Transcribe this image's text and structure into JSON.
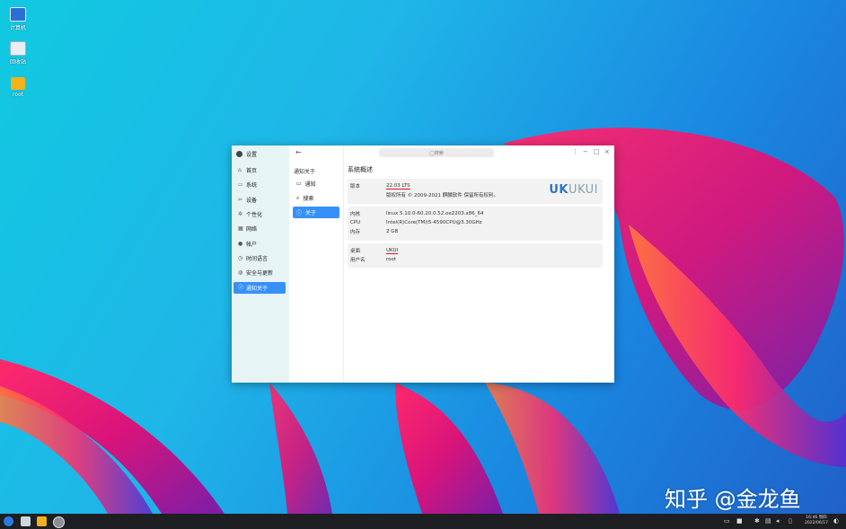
{
  "desktop": {
    "icons": [
      {
        "label": "计算机",
        "icon": "computer-icon"
      },
      {
        "label": "回收站",
        "icon": "trash-icon"
      },
      {
        "label": "root",
        "icon": "home-folder-icon"
      }
    ]
  },
  "window": {
    "title": "设置",
    "search_placeholder": "◯搜索",
    "nav": [
      {
        "label": "首页",
        "icon": "home-icon"
      },
      {
        "label": "系统",
        "icon": "system-icon"
      },
      {
        "label": "设备",
        "icon": "devices-icon"
      },
      {
        "label": "个性化",
        "icon": "personalize-icon"
      },
      {
        "label": "网络",
        "icon": "network-icon"
      },
      {
        "label": "帐户",
        "icon": "account-icon"
      },
      {
        "label": "时间语言",
        "icon": "time-language-icon"
      },
      {
        "label": "安全与更新",
        "icon": "security-update-icon"
      },
      {
        "label": "通知关于",
        "icon": "about-icon",
        "active": true
      }
    ],
    "sub": {
      "heading": "通知关于",
      "items": [
        {
          "label": "通知",
          "icon": "notification-icon"
        },
        {
          "label": "搜索",
          "icon": "search-icon"
        },
        {
          "label": "关于",
          "icon": "info-icon",
          "active": true
        }
      ]
    },
    "about": {
      "heading": "系统概述",
      "version_label": "版本",
      "version_value": "22.03 LTS",
      "copyright": "版权所有 © 2009-2021 麒麟软件 保留所有权利。",
      "brand_uk": "UK",
      "brand_ui": "UKUI",
      "kernel_label": "内核",
      "kernel_value": "linux 5.10.0-60.20.0.52.oe2203.x86_64",
      "cpu_label": "CPU",
      "cpu_value": "Intel(R)Core(TM)i5-4590CPU@3.30GHz",
      "memory_label": "内存",
      "memory_value": "2 GB",
      "desktop_label": "桌面",
      "desktop_value": "UKUI",
      "user_label": "用户名",
      "user_value": "root"
    }
  },
  "watermark": "知乎 @金龙鱼",
  "taskbar": {
    "clock_time": "16:46 周四",
    "clock_date": "2022/06/17"
  },
  "colors": {
    "accent": "#3790fa",
    "underline": "#e0102a",
    "taskbar": "#1e1f22"
  }
}
